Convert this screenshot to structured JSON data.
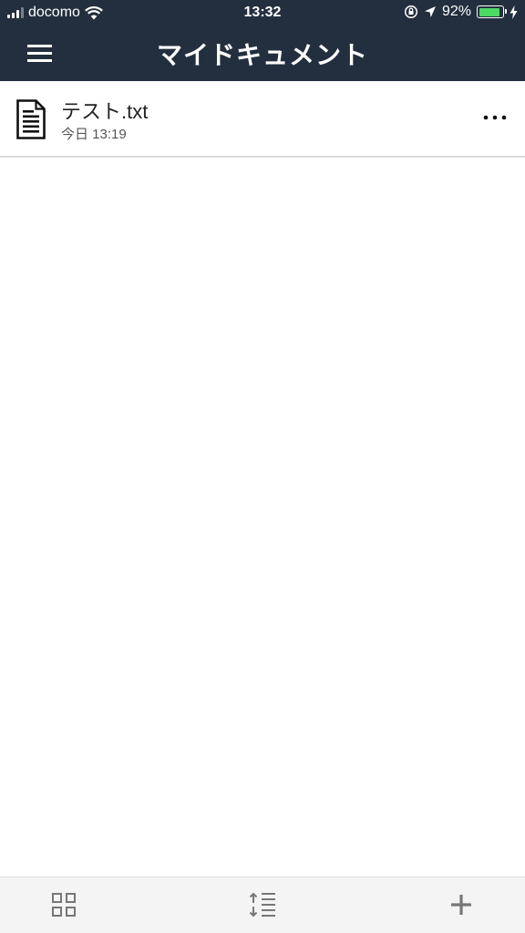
{
  "status_bar": {
    "carrier": "docomo",
    "time": "13:32",
    "battery_percent": "92%",
    "battery_level": 0.92,
    "icons": [
      "signal-icon",
      "wifi-icon",
      "orientation-lock-icon",
      "location-icon",
      "battery-icon",
      "charging-icon"
    ]
  },
  "header": {
    "title": "マイドキュメント",
    "menu_icon": "hamburger-menu-icon"
  },
  "documents": [
    {
      "name": "テスト.txt",
      "date": "今日 13:19",
      "icon": "text-document-icon",
      "more_icon": "more-options-icon"
    }
  ],
  "toolbar": {
    "items": [
      {
        "icon": "grid-view-icon"
      },
      {
        "icon": "sort-icon"
      },
      {
        "icon": "add-icon"
      }
    ]
  },
  "colors": {
    "header_bg": "#232f3e",
    "battery_fill": "#4cd964",
    "toolbar_bg": "#f4f4f4"
  }
}
